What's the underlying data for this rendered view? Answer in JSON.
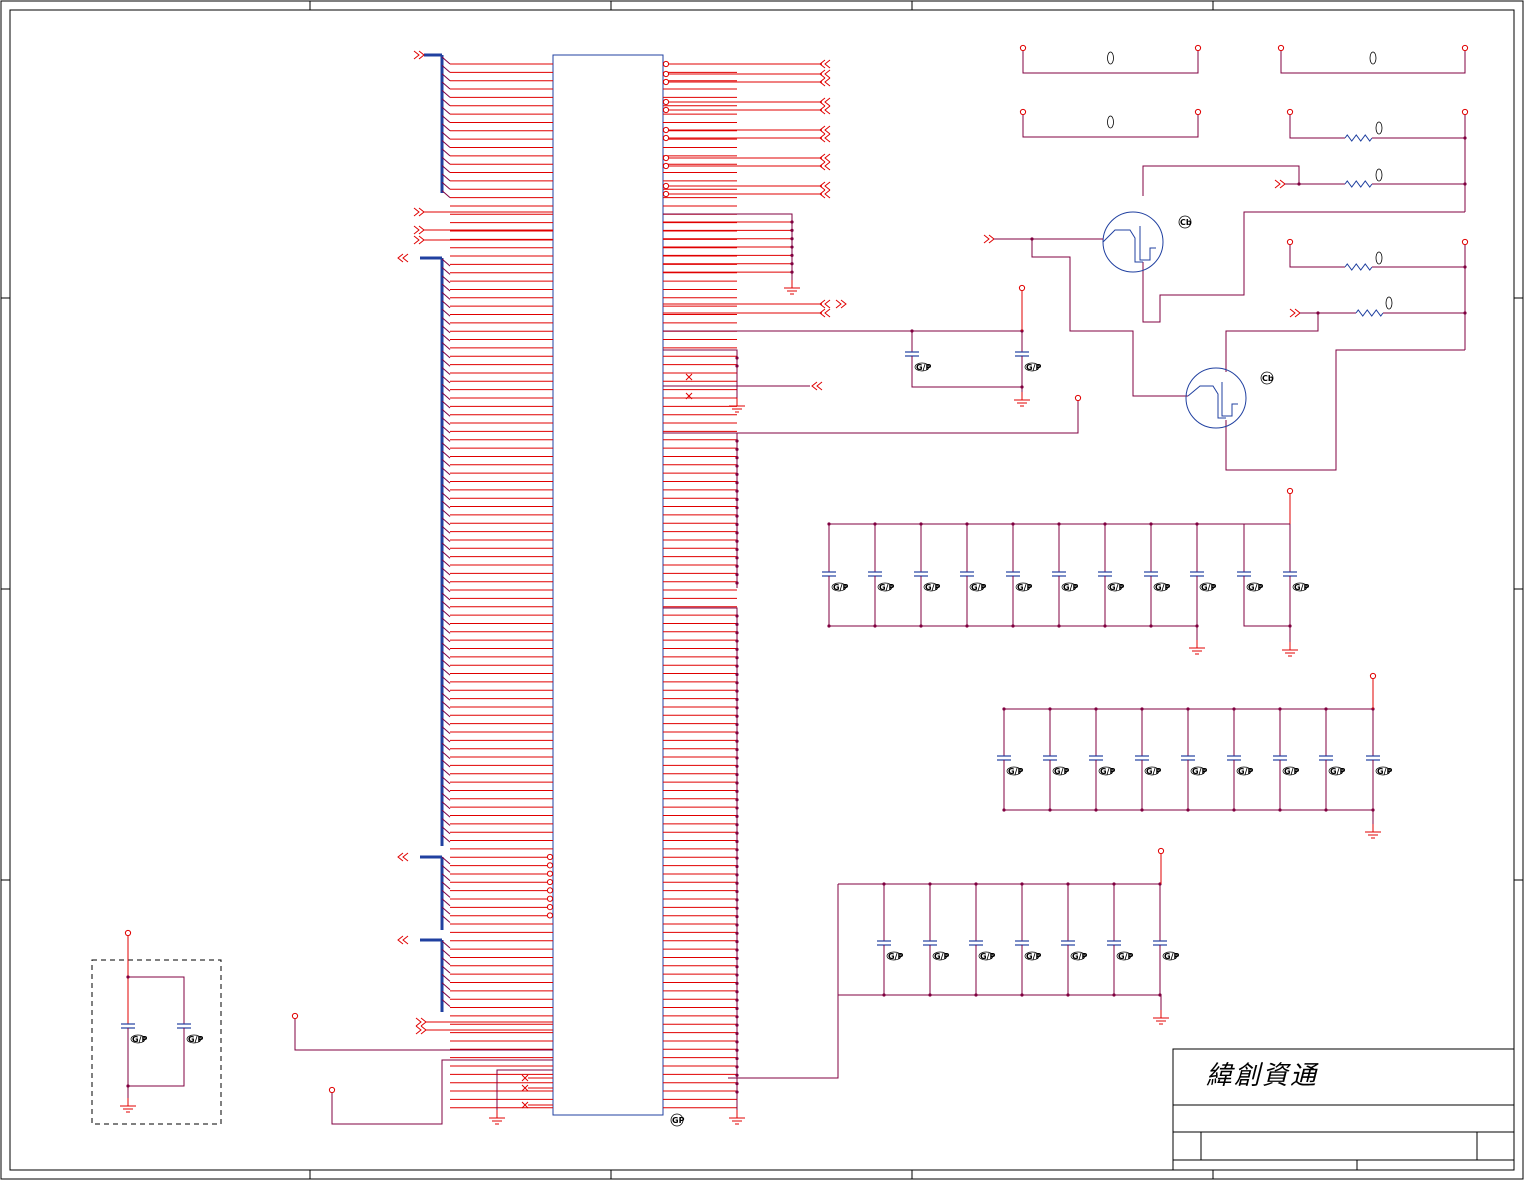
{
  "title_block": {
    "company": "緯創資通"
  },
  "labels": {
    "cap": "G/P",
    "mosfet": "Cb",
    "connector": "GP",
    "res": "O"
  },
  "colors": {
    "wire": "#800040",
    "net": "#e00000",
    "bus": "#2040a0",
    "part": "#2040a0",
    "frame": "#000000"
  }
}
